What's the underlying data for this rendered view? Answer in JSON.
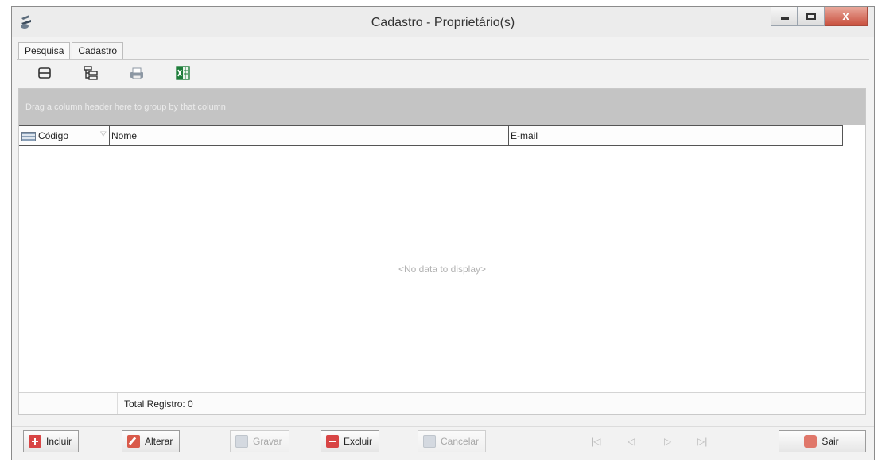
{
  "window": {
    "title": "Cadastro - Proprietário(s)",
    "close_glyph": "x"
  },
  "tabs": [
    {
      "label": "Pesquisa",
      "active": true
    },
    {
      "label": "Cadastro",
      "active": false
    }
  ],
  "toolbar": {
    "icons": [
      "group-icon",
      "tree-icon",
      "print-icon",
      "excel-icon"
    ]
  },
  "grid": {
    "group_panel_text": "Drag a column header here to group by that column",
    "columns": [
      "Código",
      "Nome",
      "E-mail"
    ],
    "empty_text": "<No data to display>",
    "footer_total": "Total Registro: 0"
  },
  "buttons": {
    "incluir": "Incluir",
    "alterar": "Alterar",
    "gravar": "Gravar",
    "excluir": "Excluir",
    "cancelar": "Cancelar",
    "sair": "Sair"
  },
  "navigator": {
    "first": "|◁",
    "prev": "◁",
    "next": "▷",
    "last": "▷|"
  },
  "colors": {
    "group_panel": "#c4c4c4",
    "button_icon_red": "#d84545",
    "excel_green": "#1e7d3a"
  }
}
